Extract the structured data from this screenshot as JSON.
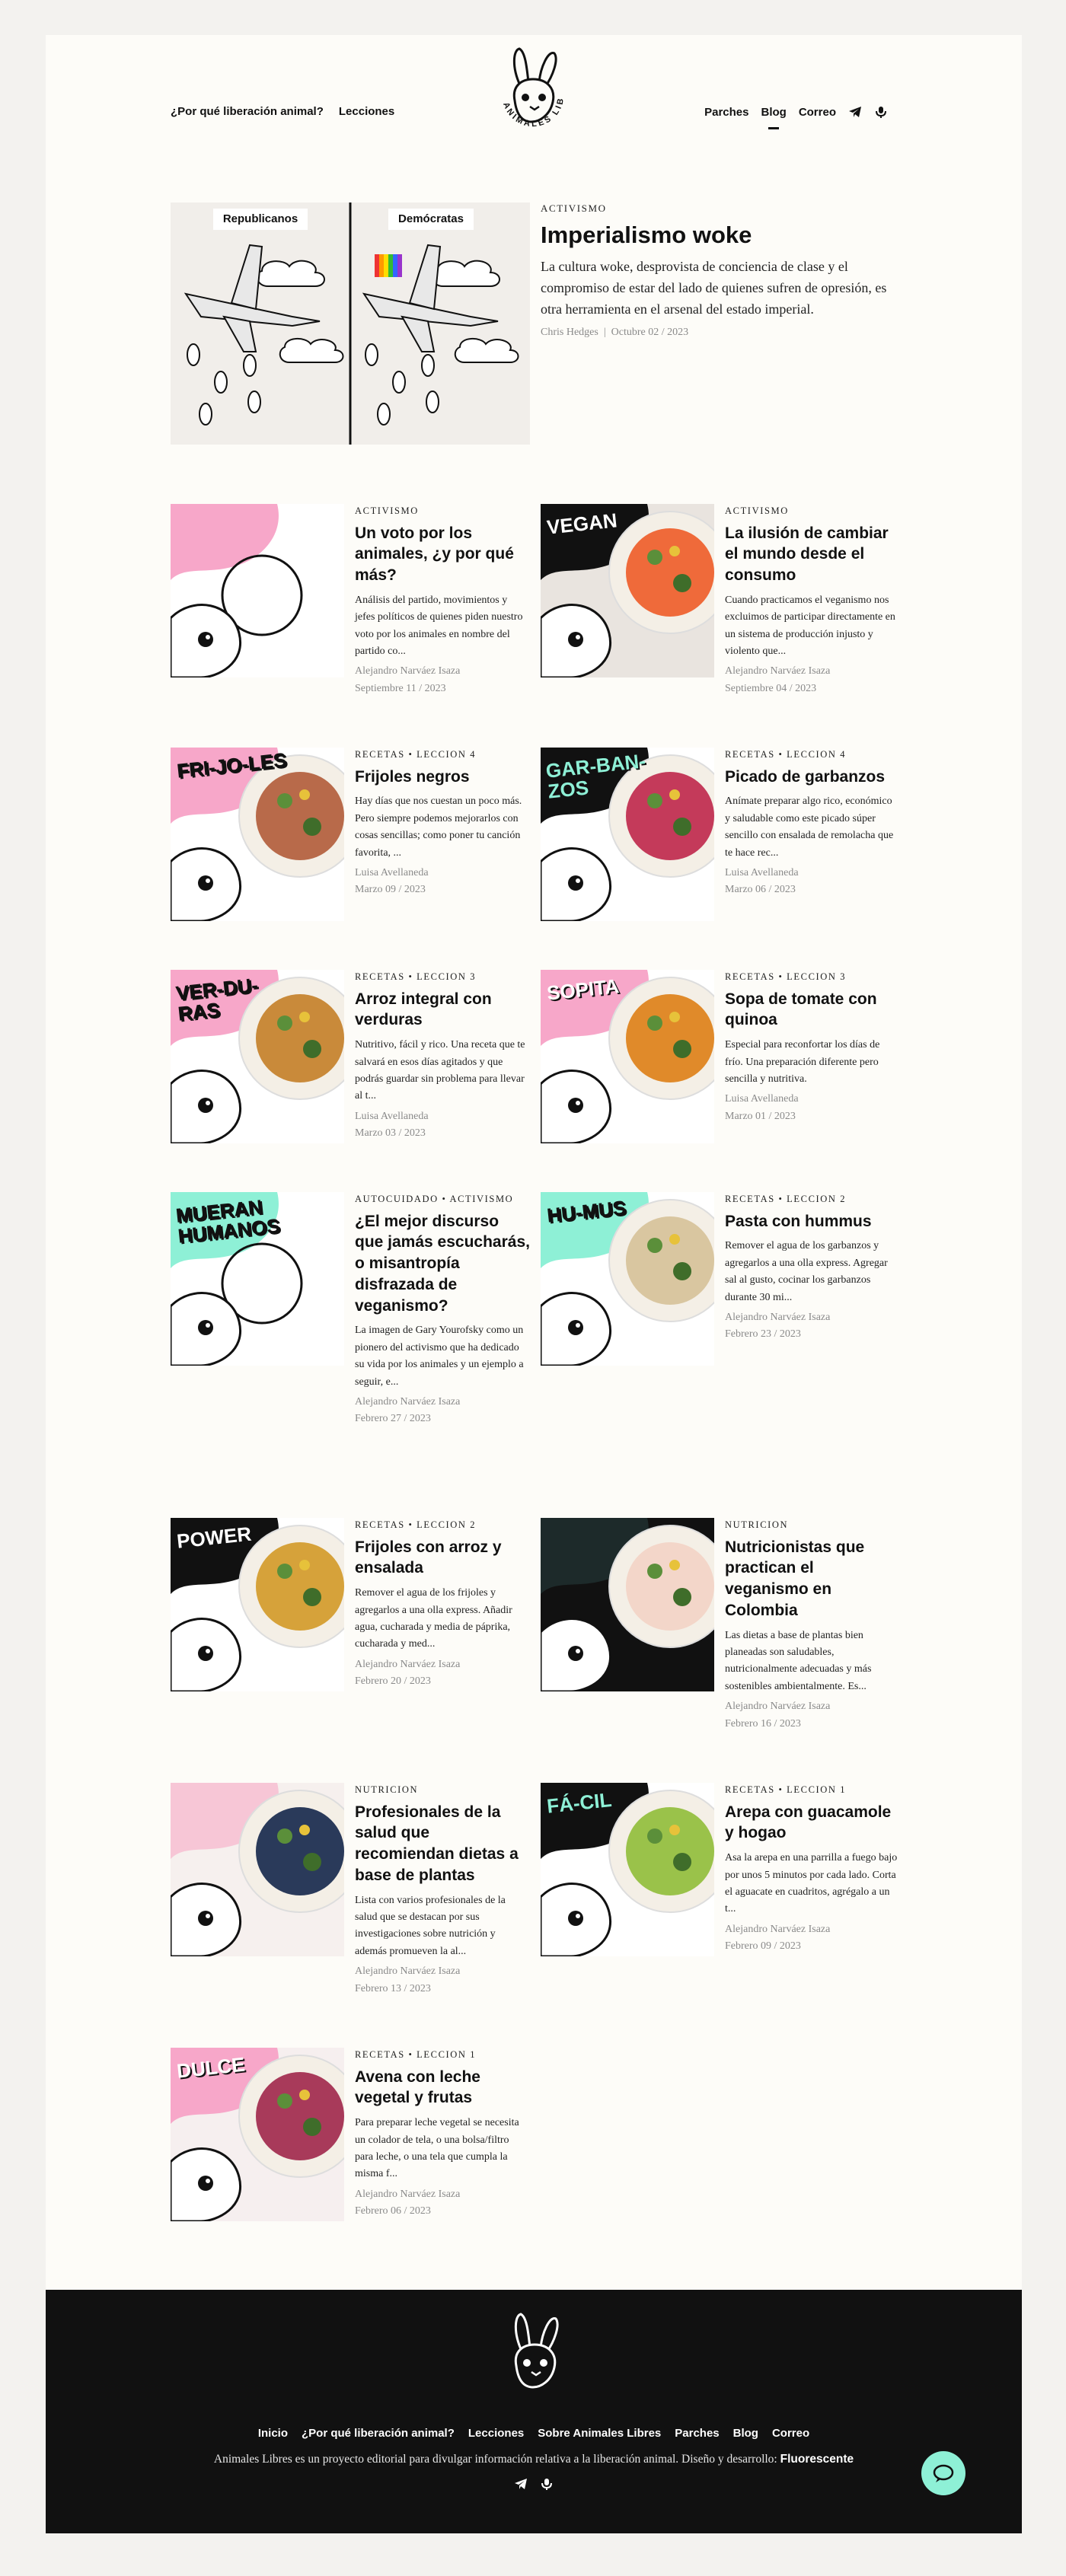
{
  "colors": {
    "page_bg": "#fdfcf8",
    "mint": "#8ef0d6",
    "pink": "#f7a7c9",
    "footer_bg": "#111111",
    "meta_gray": "#8a8a8a"
  },
  "header": {
    "logo_icon": "rabbit-logo-icon",
    "logo_text": "ANIMALES LIBRES",
    "nav_left": [
      "¿Por qué liberación animal?",
      "Lecciones"
    ],
    "nav_right": [
      "Parches",
      "Blog",
      "Correo"
    ],
    "active_item": "Blog",
    "icons": [
      "telegram-icon",
      "podcast-icon"
    ]
  },
  "featured": {
    "image_labels": [
      "Republicanos",
      "Demócratas"
    ],
    "category": "ACTIVISMO",
    "title": "Imperialismo woke",
    "excerpt": "La cultura woke, desprovista de conciencia de clase y el compromiso de estar del lado de quienes sufren de opresión, es otra herramienta en el arsenal del estado imperial.",
    "author": "Chris Hedges",
    "separator": "|",
    "date": "Octubre 02 / 2023"
  },
  "posts": [
    {
      "category": "ACTIVISMO",
      "title": "Un voto por los animales, ¿y por qué más?",
      "excerpt": "Análisis del partido, movimientos y jefes políticos de quienes piden nuestro voto por los animales en nombre del partido co...",
      "author": "Alejandro Narváez Isaza",
      "date": "Septiembre 11 / 2023"
    },
    {
      "category": "ACTIVISMO",
      "title": "La ilusión de cambiar el mundo desde el consumo",
      "excerpt": "Cuando practicamos el veganismo nos excluimos de participar directamente en un sistema de producción injusto y violento que...",
      "author": "Alejandro Narváez Isaza",
      "date": "Septiembre 04 / 2023",
      "image_text": "VEGAN"
    },
    {
      "category": "RECETAS • LECCION 4",
      "title": "Frijoles negros",
      "excerpt": "Hay días que nos cuestan un poco más. Pero siempre podemos mejorarlos con cosas sencillas; como poner tu canción favorita, ...",
      "author": "Luisa Avellaneda",
      "date": "Marzo 09 / 2023",
      "image_text": "FRI-JO-LES"
    },
    {
      "category": "RECETAS • LECCION 4",
      "title": "Picado de garbanzos",
      "excerpt": "Anímate preparar algo rico, económico y saludable como este picado súper sencillo con ensalada de remolacha que te hace rec...",
      "author": "Luisa Avellaneda",
      "date": "Marzo 06 / 2023",
      "image_text": "GAR-BAN-ZOS"
    },
    {
      "category": "RECETAS • LECCION 3",
      "title": "Arroz integral con verduras",
      "excerpt": "Nutritivo, fácil y rico. Una receta que te salvará en esos días agitados y que podrás guardar sin problema para llevar al t...",
      "author": "Luisa Avellaneda",
      "date": "Marzo 03 / 2023",
      "image_text": "VER-DU-RAS"
    },
    {
      "category": "RECETAS • LECCION 3",
      "title": "Sopa de tomate con quinoa",
      "excerpt": "Especial para reconfortar los días de frío. Una preparación diferente pero sencilla y nutritiva.",
      "author": "Luisa Avellaneda",
      "date": "Marzo 01 / 2023",
      "image_text": "SOPITA"
    },
    {
      "category": "AUTOCUIDADO • ACTIVISMO",
      "title": "¿El mejor discurso que jamás escucharás, o misantropía disfrazada de veganismo?",
      "excerpt": "La imagen de Gary Yourofsky como un pionero del activismo que ha dedicado su vida por los animales y un ejemplo a seguir, e...",
      "author": "Alejandro Narváez Isaza",
      "date": "Febrero 27 / 2023",
      "image_text": "MUERAN HUMANOS"
    },
    {
      "category": "RECETAS • LECCION 2",
      "title": "Pasta con hummus",
      "excerpt": "Remover el agua de los garbanzos y agregarlos a una olla express. Agregar sal al gusto, cocinar los garbanzos durante 30 mi...",
      "author": "Alejandro Narváez Isaza",
      "date": "Febrero 23 / 2023",
      "image_text": "HU-MUS"
    },
    {
      "category": "RECETAS • LECCION 2",
      "title": "Frijoles con arroz y ensalada",
      "excerpt": "Remover el agua de los frijoles y agregarlos a una olla express. Añadir agua, cucharada y media de páprika, cucharada y med...",
      "author": "Alejandro Narváez Isaza",
      "date": "Febrero 20 / 2023",
      "image_text": "POWER"
    },
    {
      "category": "NUTRICION",
      "title": "Nutricionistas que practican el veganismo en Colombia",
      "excerpt": "Las dietas a base de plantas bien planeadas son saludables, nutricionalmente adecuadas y más sostenibles ambientalmente. Es...",
      "author": "Alejandro Narváez Isaza",
      "date": "Febrero 16 / 2023"
    },
    {
      "category": "NUTRICION",
      "title": "Profesionales de la salud que recomiendan dietas a base de plantas",
      "excerpt": "Lista con varios profesionales de la salud que se destacan por sus investigaciones sobre nutrición y además promueven la al...",
      "author": "Alejandro Narváez Isaza",
      "date": "Febrero 13 / 2023"
    },
    {
      "category": "RECETAS • LECCION 1",
      "title": "Arepa con guacamole y hogao",
      "excerpt": "Asa la arepa en una parrilla a fuego bajo por unos 5 minutos por cada lado. Corta el aguacate en cuadritos, agrégalo a un t...",
      "author": "Alejandro Narváez Isaza",
      "date": "Febrero 09 / 2023",
      "image_text": "FÁ-CIL"
    },
    {
      "category": "RECETAS • LECCION 1",
      "title": "Avena con leche vegetal y frutas",
      "excerpt": "Para preparar leche vegetal se necesita un colador de tela, o una bolsa/filtro para leche, o una tela que cumpla la misma f...",
      "author": "Alejandro Narváez Isaza",
      "date": "Febrero 06 / 2023",
      "image_text": "DULCE"
    }
  ],
  "footer": {
    "nav": [
      "Inicio",
      "¿Por qué liberación animal?",
      "Lecciones",
      "Sobre Animales Libres",
      "Parches",
      "Blog",
      "Correo"
    ],
    "text": "Animales Libres es un proyecto editorial para divulgar información relativa a la liberación animal. Diseño y desarrollo:",
    "credit": "Fluorescente",
    "icons": [
      "telegram-icon",
      "podcast-icon"
    ]
  },
  "chat_button": {
    "icon": "chat-icon"
  }
}
